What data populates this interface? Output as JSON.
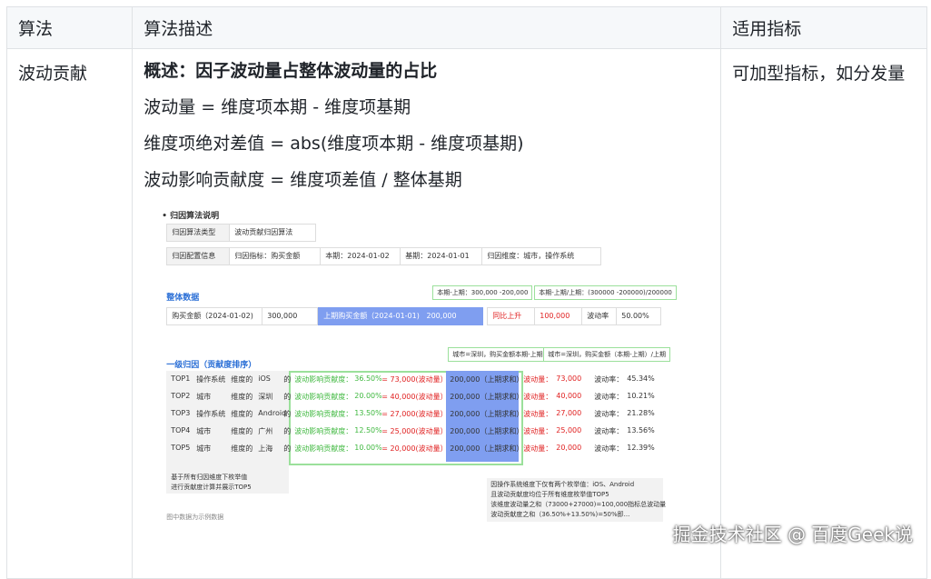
{
  "table": {
    "headers": [
      "算法",
      "算法描述",
      "适用指标"
    ],
    "row": {
      "name": "波动贡献",
      "desc_lines": [
        "概述：因子波动量占整体波动量的占比",
        "波动量 = 维度项本期 - 维度项基期",
        "维度项绝对差值 = abs(维度项本期 - 维度项基期)",
        "波动影响贡献度 = 维度项差值 / 整体基期"
      ],
      "applicable": "可加型指标，如分发量"
    }
  },
  "figure": {
    "section1_title": "归因算法说明",
    "algo_type_label": "归因算法类型",
    "algo_type_value": "波动贡献归因算法",
    "config_label": "归因配置信息",
    "config_metric": "归因指标：购买金额",
    "config_current": "本期：2024-01-02",
    "config_base": "基期：2024-01-01",
    "config_dims": "归因维度：城市，操作系统",
    "overall_title": "整体数据",
    "note_diff": "本期-上期：300,000 -200,000",
    "note_rate": "本期-上期/上期：(300000 -200000)/200000",
    "overall_label": "购买金额（2024-01-02)",
    "overall_value": "300,000",
    "overall_base_label": "上期购买金额（2024-01-01)",
    "overall_base_value": "200,000",
    "yoy_label": "同比上升",
    "yoy_value": "100,000",
    "rate_label": "波动率",
    "rate_value": "50.00%",
    "level1_title": "一级归因（贡献度排序）",
    "note_city_diff": "城市=深圳，购买金额本期-上期",
    "note_city_rate": "城市=深圳，购买金额（本期-上期）/上期",
    "rows": [
      {
        "rank": "TOP1",
        "dim": "操作系统",
        "mid": "维度的",
        "item": "iOS",
        "suffix": "的",
        "impact": "波动影响贡献度：",
        "pct": "36.50%",
        "eq": "= 73,000(波动量）",
        "base": "200,000（上期求和）",
        "wave_label": "波动量：",
        "wave": "73,000",
        "rate_label": "波动率：",
        "rate": "45.34%"
      },
      {
        "rank": "TOP2",
        "dim": "城市",
        "mid": "维度的",
        "item": "深圳",
        "suffix": "的",
        "impact": "波动影响贡献度：",
        "pct": "20.00%",
        "eq": "= 40,000(波动量）",
        "base": "200,000（上期求和）",
        "wave_label": "波动量：",
        "wave": "40,000",
        "rate_label": "波动率：",
        "rate": "10.21%"
      },
      {
        "rank": "TOP3",
        "dim": "操作系统",
        "mid": "维度的",
        "item": "Android",
        "suffix": "的",
        "impact": "波动影响贡献度：",
        "pct": "13.50%",
        "eq": "= 27,000(波动量）",
        "base": "200,000（上期求和）",
        "wave_label": "波动量：",
        "wave": "27,000",
        "rate_label": "波动率：",
        "rate": "21.28%"
      },
      {
        "rank": "TOP4",
        "dim": "城市",
        "mid": "维度的",
        "item": "广州",
        "suffix": "的",
        "impact": "波动影响贡献度：",
        "pct": "12.50%",
        "eq": "= 25,000(波动量）",
        "base": "200,000（上期求和）",
        "wave_label": "波动量：",
        "wave": "25,000",
        "rate_label": "波动率：",
        "rate": "13.56%"
      },
      {
        "rank": "TOP5",
        "dim": "城市",
        "mid": "维度的",
        "item": "上海",
        "suffix": "的",
        "impact": "波动影响贡献度：",
        "pct": "10.00%",
        "eq": "= 20,000(波动量）",
        "base": "200,000（上期求和）",
        "wave_label": "波动量：",
        "wave": "20,000",
        "rate_label": "波动率：",
        "rate": "12.39%"
      }
    ],
    "left_note": [
      "基于所有归因维度下枚举值",
      "进行贡献度计算并展示TOP5"
    ],
    "right_note": [
      "因操作系统维度下仅有两个枚举值：iOS、Android",
      "且波动贡献度均位于所有维度枚举值TOP5",
      "该维度波动量之和（73000+27000)=100,000指标总波动量",
      "波动贡献度之和（36.50%+13.50%)=50%即..."
    ],
    "footnote": "图中数据为示例数据"
  },
  "watermark": "掘金技术社区 @ 百度Geek说"
}
